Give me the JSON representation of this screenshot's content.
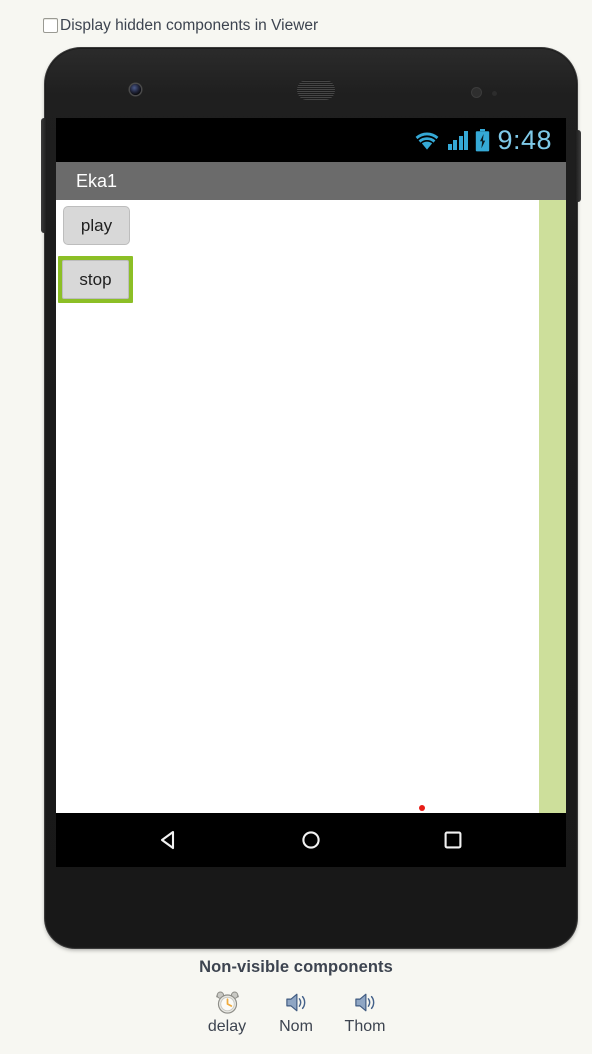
{
  "viewer_toggle": {
    "label": "Display hidden components in Viewer",
    "checked": false,
    "checkbox_icon": "checkbox-unchecked-icon"
  },
  "phone": {
    "hardware": {
      "camera_icon": "front-camera-icon",
      "earpiece_icon": "earpiece-speaker-icon",
      "proximity_sensor_icon": "proximity-sensor-icon",
      "light_sensor_icon": "light-sensor-icon",
      "volume_key": "volume-rocker-button",
      "power_key": "power-button"
    },
    "statusbar": {
      "wifi_icon": "wifi-icon",
      "signal_icon": "cellular-signal-icon",
      "battery_icon": "battery-charging-icon",
      "time": "9:48",
      "accent_color": "#35a9d6",
      "time_color": "#7ec9e8",
      "background": "#000000"
    },
    "titlebar": {
      "title": "Eka1",
      "background": "#6b6b6b",
      "text_color": "#ffffff"
    },
    "canvas": {
      "background": "#ffffff",
      "scrollbar_color": "#cddf9b",
      "selection_color": "#8cbf26",
      "marker_color": "#e71d17",
      "buttons": [
        {
          "name": "play-button",
          "label": "play",
          "selected": false
        },
        {
          "name": "stop-button",
          "label": "stop",
          "selected": true
        }
      ]
    },
    "navbar": {
      "back_icon": "back-triangle-icon",
      "home_icon": "home-circle-icon",
      "recents_icon": "recents-square-icon",
      "background": "#000000",
      "icon_color": "#ffffff"
    }
  },
  "non_visible": {
    "title": "Non-visible components",
    "items": [
      {
        "icon": "clock-alarm-icon",
        "label": "delay"
      },
      {
        "icon": "speaker-sound-icon",
        "label": "Nom"
      },
      {
        "icon": "speaker-sound-icon",
        "label": "Thom"
      }
    ]
  }
}
